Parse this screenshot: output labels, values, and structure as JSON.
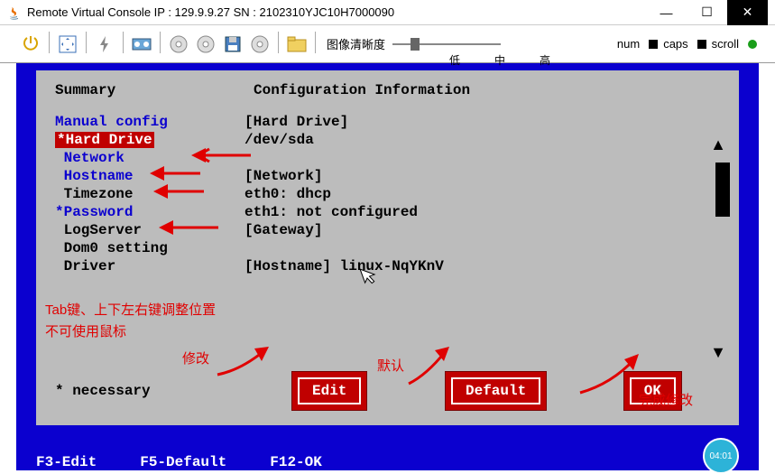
{
  "titlebar": {
    "title": "Remote Virtual Console   IP : 129.9.9.27   SN : 2102310YJC10H7000090"
  },
  "toolbar": {
    "clarity_label": "图像清晰度",
    "slider_marks": {
      "low": "低",
      "mid": "中",
      "high": "高"
    },
    "status": {
      "num": "num",
      "caps": "caps",
      "scroll": "scroll"
    }
  },
  "tui": {
    "summary_header": "Summary",
    "conf_header": "Configuration Information",
    "summary": [
      {
        "text": "Manual config",
        "prefix": "",
        "color": "blue"
      },
      {
        "text": "Hard Drive",
        "prefix": "*",
        "selected": true
      },
      {
        "text": "Network",
        "prefix": " ",
        "color": "blue"
      },
      {
        "text": "Hostname",
        "prefix": " ",
        "color": "blue"
      },
      {
        "text": "Timezone",
        "prefix": " "
      },
      {
        "text": "Password",
        "prefix": "*",
        "color": "blue"
      },
      {
        "text": "LogServer",
        "prefix": " "
      },
      {
        "text": "Dom0 setting",
        "prefix": " "
      },
      {
        "text": "Driver",
        "prefix": " "
      }
    ],
    "conf": [
      "[Hard Drive]",
      "/dev/sda",
      "",
      "[Network]",
      "eth0: dhcp",
      "eth1: not configured",
      "[Gateway]",
      "",
      "[Hostname] linux-NqYKnV"
    ],
    "necessary_label": "* necessary",
    "buttons": {
      "edit": "Edit",
      "default": "Default",
      "ok": "OK"
    }
  },
  "fkeys": {
    "f3": "F3-Edit",
    "f5": "F5-Default",
    "f12": "F12-OK"
  },
  "clock": "04:01",
  "annotations": {
    "tab_hint_1": "Tab键、上下左右键调整位置",
    "tab_hint_2": "不可使用鼠标",
    "edit_label": "修改",
    "default_label": "默认",
    "ok_label": "完成修改"
  }
}
